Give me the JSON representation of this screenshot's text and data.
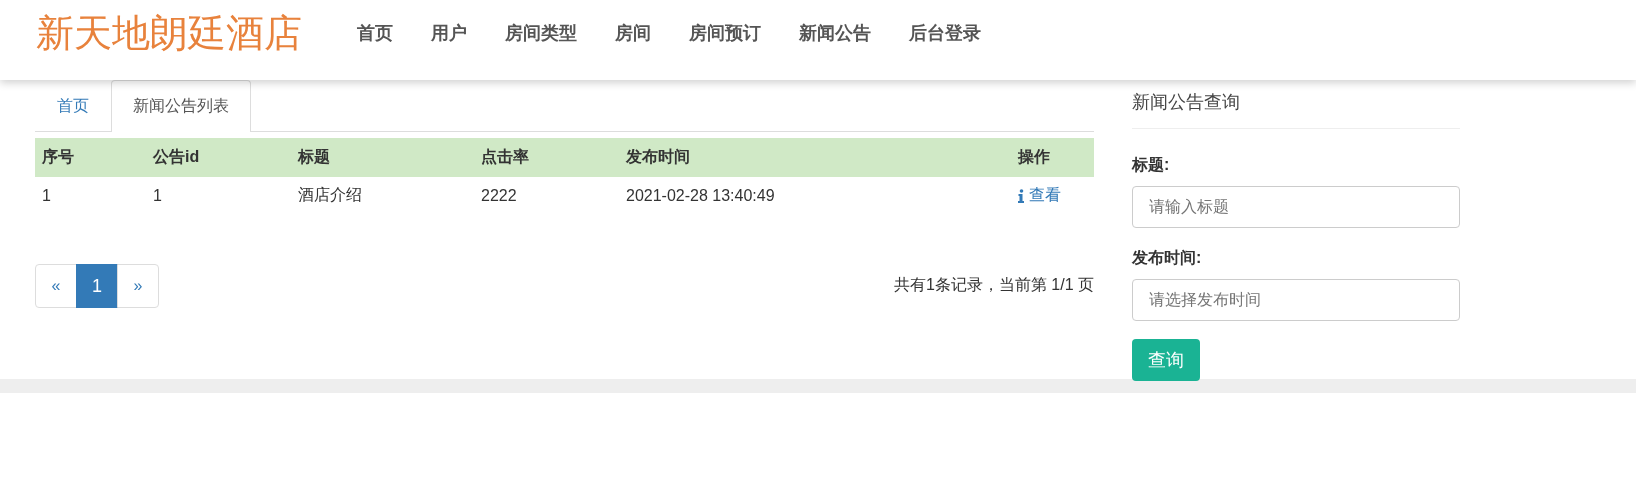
{
  "brand": "新天地朗廷酒店",
  "nav": [
    "首页",
    "用户",
    "房间类型",
    "房间",
    "房间预订",
    "新闻公告",
    "后台登录"
  ],
  "tabs": [
    {
      "label": "首页",
      "selected": false
    },
    {
      "label": "新闻公告列表",
      "selected": true
    }
  ],
  "table": {
    "columns": [
      "序号",
      "公告id",
      "标题",
      "点击率",
      "发布时间",
      "操作"
    ],
    "rows": [
      {
        "cells": [
          "1",
          "1",
          "酒店介绍",
          "2222",
          "2021-02-28 13:40:49"
        ],
        "action": "查看"
      }
    ]
  },
  "pagination": {
    "prev": "«",
    "pages": [
      {
        "label": "1",
        "selected": true
      }
    ],
    "next": "»"
  },
  "summary": "共有1条记录，当前第 1/1 页",
  "search": {
    "title": "新闻公告查询",
    "fields": [
      {
        "label": "标题:",
        "placeholder": "请输入标题"
      },
      {
        "label": "发布时间:",
        "placeholder": "请选择发布时间"
      }
    ],
    "button": "查询"
  }
}
